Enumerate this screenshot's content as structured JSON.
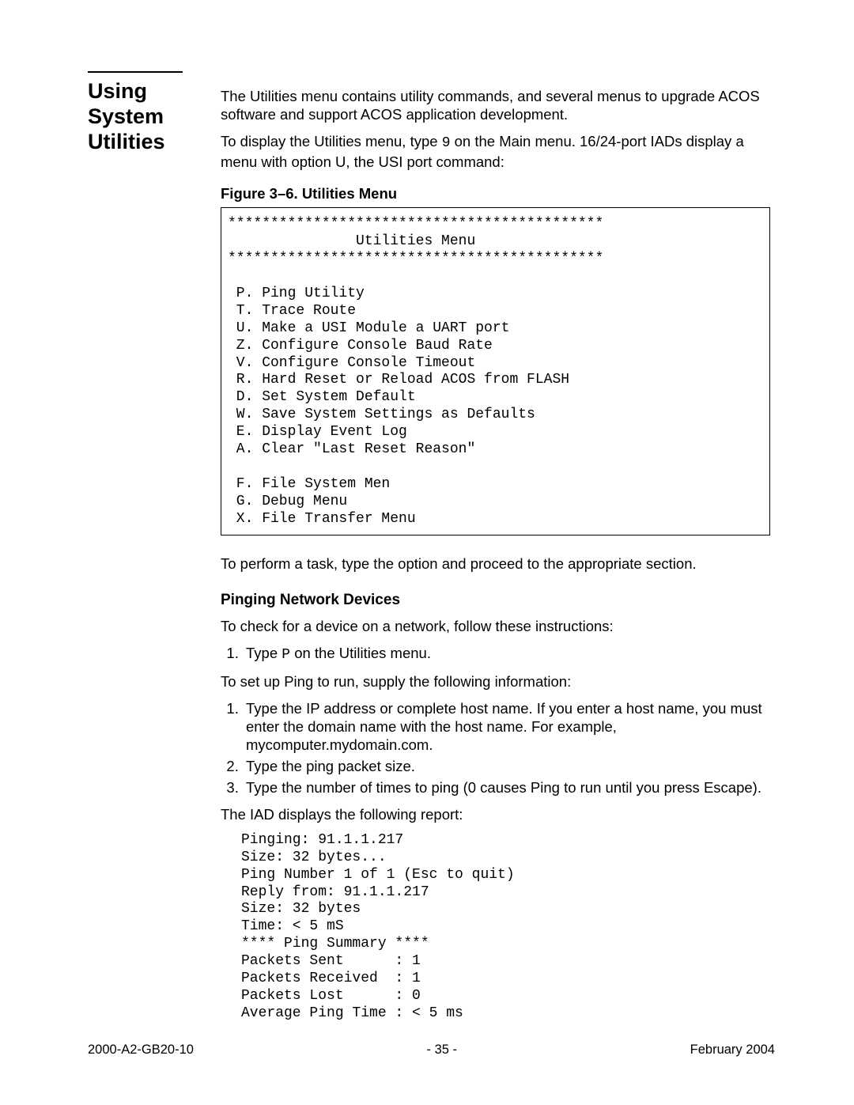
{
  "sidebar": {
    "title_line1": "Using",
    "title_line2": "System",
    "title_line3": "Utilities"
  },
  "content": {
    "intro_p1": "The Utilities menu contains utility commands, and several menus to upgrade ACOS software and support ACOS application development.",
    "intro_p2a": "To display the Utilities menu, type ",
    "intro_p2_code": "9",
    "intro_p2b": " on the Main menu. 16/24-port IADs display a menu with option U, the USI port command:",
    "fig_caption": "Figure 3–6.  Utilities Menu",
    "fig_body": "********************************************\n               Utilities Menu\n********************************************\n\n P. Ping Utility\n T. Trace Route\n U. Make a USI Module a UART port\n Z. Configure Console Baud Rate\n V. Configure Console Timeout\n R. Hard Reset or Reload ACOS from FLASH\n D. Set System Default\n W. Save System Settings as Defaults\n E. Display Event Log\n A. Clear \"Last Reset Reason\"\n\n F. File System Men\n G. Debug Menu\n X. File Transfer Menu",
    "after_fig": "To perform a task, type the option and proceed to the appropriate section.",
    "subhead": "Pinging Network Devices",
    "ping_intro": "To check for a device on a network, follow these instructions:",
    "step1a": "Type ",
    "step1_code": "P",
    "step1b": " on the Utilities menu.",
    "setup_intro": "To set up Ping to run, supply the following information:",
    "setup_steps": [
      "Type the IP address or complete host name. If you enter a host name, you must enter the domain name with the host name. For example, mycomputer.mydomain.com.",
      "Type the ping packet size.",
      "Type the number of times to ping (0 causes Ping to run until you press Escape)."
    ],
    "report_intro": "The IAD displays the following report:",
    "report_block": "Pinging: 91.1.1.217\nSize: 32 bytes...\nPing Number 1 of 1 (Esc to quit)\nReply from: 91.1.1.217\nSize: 32 bytes\nTime: < 5 mS\n**** Ping Summary ****\nPackets Sent      : 1\nPackets Received  : 1\nPackets Lost      : 0\nAverage Ping Time : < 5 ms"
  },
  "footer": {
    "left": "2000-A2-GB20-10",
    "center": "- 35 -",
    "right": "February 2004"
  }
}
